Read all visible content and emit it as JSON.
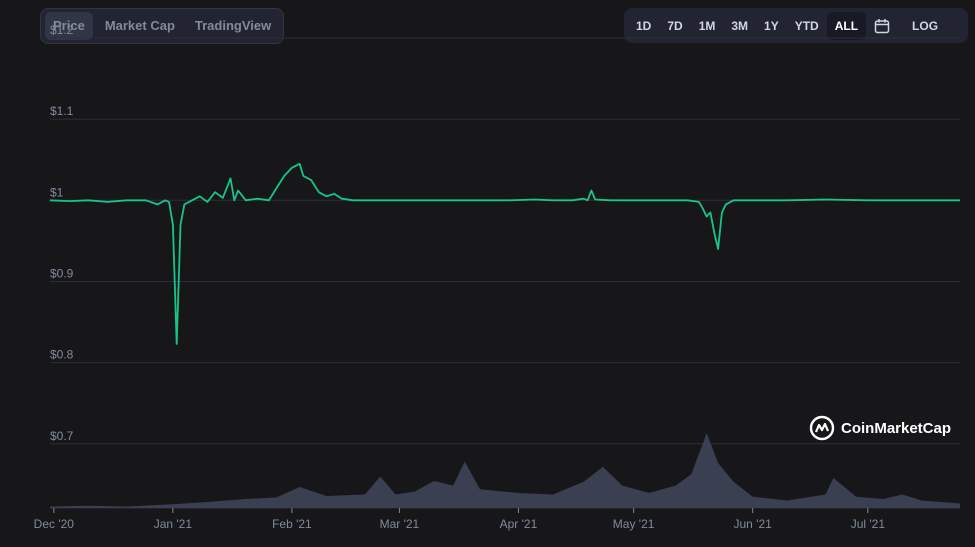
{
  "price_tabs": [
    {
      "label": "Price",
      "active": true
    },
    {
      "label": "Market Cap",
      "active": false
    },
    {
      "label": "TradingView",
      "active": false
    }
  ],
  "range_tabs": [
    {
      "label": "1D",
      "active": false
    },
    {
      "label": "7D",
      "active": false
    },
    {
      "label": "1M",
      "active": false
    },
    {
      "label": "3M",
      "active": false
    },
    {
      "label": "1Y",
      "active": false
    },
    {
      "label": "YTD",
      "active": false
    },
    {
      "label": "ALL",
      "active": true
    }
  ],
  "calendar_icon": "calendar-icon",
  "log_label": "LOG",
  "watermark": {
    "text": "CoinMarketCap",
    "icon": "coinmarketcap-logo-icon"
  },
  "colors": {
    "background": "#17171a",
    "price_line": "#16c784",
    "volume_fill": "#3a3f52",
    "grid": "#2b2e3d",
    "axis_text": "#808a9d"
  },
  "chart_data": {
    "type": "line",
    "title": "",
    "xlabel": "",
    "ylabel": "",
    "y_ticks": [
      "$0.7",
      "$0.8",
      "$0.9",
      "$1",
      "$1.1",
      "$1.2"
    ],
    "ylim": [
      0.68,
      1.2
    ],
    "x_ticks": [
      "Dec '20",
      "Jan '21",
      "Feb '21",
      "Mar '21",
      "Apr '21",
      "May '21",
      "Jun '21",
      "Jul '21"
    ],
    "x_tick_dates": [
      "2020-12-01",
      "2021-01-01",
      "2021-02-01",
      "2021-03-01",
      "2021-04-01",
      "2021-05-01",
      "2021-06-01",
      "2021-07-01"
    ],
    "xlim": [
      "2020-11-30",
      "2021-07-25"
    ],
    "grid": true,
    "series": [
      {
        "type": "line",
        "points": [
          [
            "2020-11-30",
            1.0
          ],
          [
            "2020-12-05",
            0.999
          ],
          [
            "2020-12-10",
            1.0
          ],
          [
            "2020-12-15",
            0.998
          ],
          [
            "2020-12-20",
            1.0
          ],
          [
            "2020-12-25",
            1.0
          ],
          [
            "2020-12-28",
            0.995
          ],
          [
            "2020-12-30",
            1.0
          ],
          [
            "2020-12-31",
            0.998
          ],
          [
            "2021-01-01",
            0.97
          ],
          [
            "2021-01-02",
            0.823
          ],
          [
            "2021-01-03",
            0.97
          ],
          [
            "2021-01-04",
            0.995
          ],
          [
            "2021-01-06",
            1.0
          ],
          [
            "2021-01-08",
            1.005
          ],
          [
            "2021-01-10",
            0.998
          ],
          [
            "2021-01-12",
            1.01
          ],
          [
            "2021-01-14",
            1.003
          ],
          [
            "2021-01-16",
            1.027
          ],
          [
            "2021-01-17",
            1.0
          ],
          [
            "2021-01-18",
            1.012
          ],
          [
            "2021-01-20",
            1.0
          ],
          [
            "2021-01-23",
            1.002
          ],
          [
            "2021-01-26",
            1.0
          ],
          [
            "2021-01-28",
            1.015
          ],
          [
            "2021-01-30",
            1.03
          ],
          [
            "2021-02-01",
            1.04
          ],
          [
            "2021-02-03",
            1.045
          ],
          [
            "2021-02-04",
            1.03
          ],
          [
            "2021-02-06",
            1.025
          ],
          [
            "2021-02-08",
            1.01
          ],
          [
            "2021-02-10",
            1.005
          ],
          [
            "2021-02-12",
            1.008
          ],
          [
            "2021-02-14",
            1.002
          ],
          [
            "2021-02-17",
            1.0
          ],
          [
            "2021-02-22",
            1.0
          ],
          [
            "2021-03-01",
            1.0
          ],
          [
            "2021-03-10",
            1.0
          ],
          [
            "2021-03-20",
            1.0
          ],
          [
            "2021-03-30",
            1.0
          ],
          [
            "2021-04-05",
            1.001
          ],
          [
            "2021-04-10",
            1.0
          ],
          [
            "2021-04-15",
            1.0
          ],
          [
            "2021-04-18",
            1.002
          ],
          [
            "2021-04-19",
            1.0
          ],
          [
            "2021-04-20",
            1.012
          ],
          [
            "2021-04-21",
            1.001
          ],
          [
            "2021-04-25",
            1.0
          ],
          [
            "2021-05-01",
            1.0
          ],
          [
            "2021-05-10",
            1.0
          ],
          [
            "2021-05-15",
            1.0
          ],
          [
            "2021-05-18",
            0.998
          ],
          [
            "2021-05-19",
            0.99
          ],
          [
            "2021-05-20",
            0.98
          ],
          [
            "2021-05-21",
            0.985
          ],
          [
            "2021-05-22",
            0.96
          ],
          [
            "2021-05-23",
            0.94
          ],
          [
            "2021-05-24",
            0.985
          ],
          [
            "2021-05-25",
            0.995
          ],
          [
            "2021-05-27",
            1.0
          ],
          [
            "2021-06-01",
            1.0
          ],
          [
            "2021-06-10",
            1.0
          ],
          [
            "2021-06-20",
            1.001
          ],
          [
            "2021-07-01",
            1.0
          ],
          [
            "2021-07-10",
            1.0
          ],
          [
            "2021-07-20",
            1.0
          ],
          [
            "2021-07-25",
            1.0
          ]
        ]
      },
      {
        "type": "area",
        "role": "volume",
        "points": [
          [
            "2020-11-30",
            0.02
          ],
          [
            "2020-12-10",
            0.03
          ],
          [
            "2020-12-20",
            0.02
          ],
          [
            "2021-01-01",
            0.05
          ],
          [
            "2021-01-10",
            0.08
          ],
          [
            "2021-01-20",
            0.12
          ],
          [
            "2021-01-28",
            0.14
          ],
          [
            "2021-02-03",
            0.28
          ],
          [
            "2021-02-10",
            0.16
          ],
          [
            "2021-02-20",
            0.18
          ],
          [
            "2021-02-24",
            0.42
          ],
          [
            "2021-02-28",
            0.18
          ],
          [
            "2021-03-05",
            0.22
          ],
          [
            "2021-03-10",
            0.36
          ],
          [
            "2021-03-15",
            0.3
          ],
          [
            "2021-03-18",
            0.62
          ],
          [
            "2021-03-22",
            0.25
          ],
          [
            "2021-04-01",
            0.2
          ],
          [
            "2021-04-10",
            0.18
          ],
          [
            "2021-04-18",
            0.35
          ],
          [
            "2021-04-23",
            0.55
          ],
          [
            "2021-04-28",
            0.3
          ],
          [
            "2021-05-05",
            0.2
          ],
          [
            "2021-05-12",
            0.3
          ],
          [
            "2021-05-16",
            0.45
          ],
          [
            "2021-05-19",
            0.85
          ],
          [
            "2021-05-20",
            1.0
          ],
          [
            "2021-05-23",
            0.6
          ],
          [
            "2021-05-27",
            0.35
          ],
          [
            "2021-06-01",
            0.15
          ],
          [
            "2021-06-10",
            0.1
          ],
          [
            "2021-06-20",
            0.18
          ],
          [
            "2021-06-22",
            0.4
          ],
          [
            "2021-06-28",
            0.15
          ],
          [
            "2021-07-05",
            0.12
          ],
          [
            "2021-07-10",
            0.18
          ],
          [
            "2021-07-15",
            0.1
          ],
          [
            "2021-07-25",
            0.06
          ]
        ]
      }
    ]
  }
}
